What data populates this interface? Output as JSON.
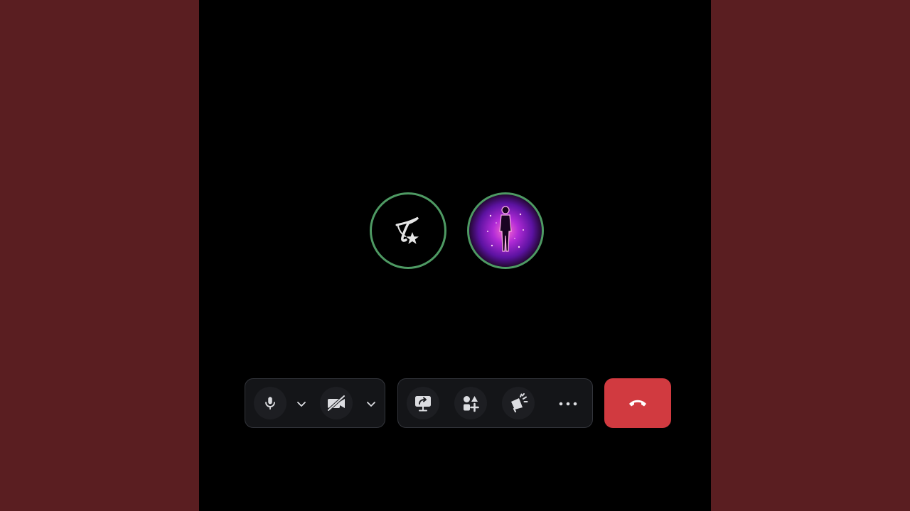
{
  "call": {
    "participants": [
      {
        "name": "",
        "avatar_icon": "calligraphy-star-logo-icon",
        "speaking": true
      },
      {
        "name": "",
        "avatar_icon": "glowing-human-figure-icon",
        "speaking": true
      }
    ],
    "ring_color": "#4e9a63"
  },
  "controls": {
    "microphone": {
      "icon": "microphone-icon",
      "state": "on"
    },
    "microphone_options": {
      "icon": "chevron-down-icon"
    },
    "camera": {
      "icon": "camera-off-icon",
      "state": "off"
    },
    "camera_options": {
      "icon": "chevron-down-icon"
    },
    "screen_share": {
      "icon": "screen-share-icon"
    },
    "activities": {
      "icon": "activities-icon"
    },
    "soundboard": {
      "icon": "soundboard-icon"
    },
    "more": {
      "icon": "more-dots-icon"
    },
    "disconnect": {
      "icon": "hang-up-icon",
      "color": "#d13a40"
    }
  },
  "colors": {
    "background": "#5a1e21",
    "stage": "#000000",
    "control_bar": "#141518",
    "icon": "#dcdde1"
  }
}
